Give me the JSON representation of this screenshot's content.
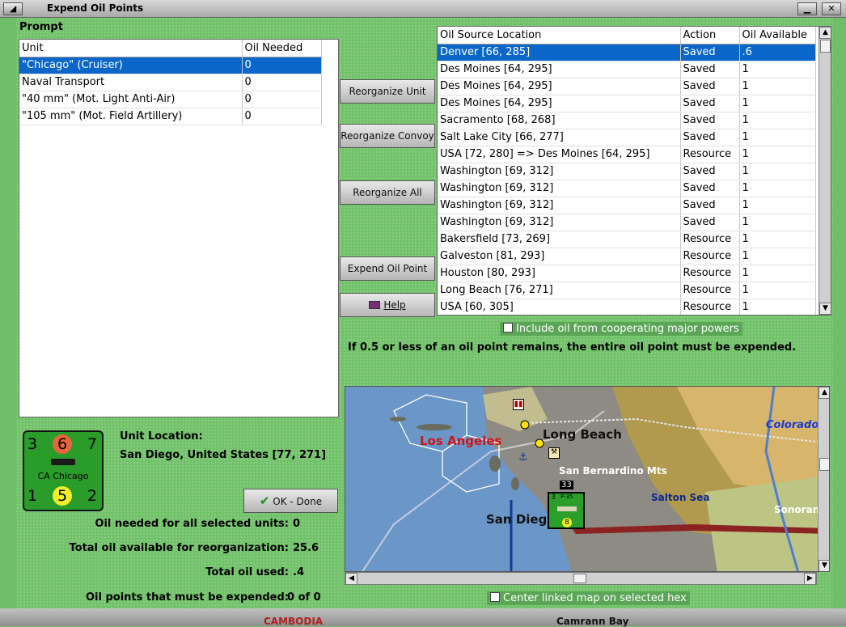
{
  "window": {
    "title": "Expend Oil Points"
  },
  "prompt_label": "Prompt",
  "units_table": {
    "headers": [
      "Unit",
      "Oil Needed"
    ],
    "rows": [
      {
        "unit": "\"Chicago\" (Cruiser)",
        "oil": "0",
        "selected": true
      },
      {
        "unit": "Naval Transport",
        "oil": "0"
      },
      {
        "unit": "\"40 mm\" (Mot. Light Anti-Air)",
        "oil": "0"
      },
      {
        "unit": "\"105 mm\" (Mot. Field Artillery)",
        "oil": "0"
      }
    ]
  },
  "buttons": {
    "reorganize_unit": "Reorganize Unit",
    "reorganize_convoy": "Reorganize Convoy",
    "reorganize_all": "Reorganize All",
    "expend_oil_point": "Expend Oil Point",
    "help": "Help",
    "ok_done": "OK - Done"
  },
  "oil_table": {
    "headers": [
      "Oil Source Location",
      "Action",
      "Oil Available"
    ],
    "rows": [
      {
        "loc": "Denver [66, 285]",
        "action": "Saved",
        "avail": ".6",
        "selected": true
      },
      {
        "loc": "Des Moines [64, 295]",
        "action": "Saved",
        "avail": "1"
      },
      {
        "loc": "Des Moines [64, 295]",
        "action": "Saved",
        "avail": "1"
      },
      {
        "loc": "Des Moines [64, 295]",
        "action": "Saved",
        "avail": "1"
      },
      {
        "loc": "Sacramento [68, 268]",
        "action": "Saved",
        "avail": "1"
      },
      {
        "loc": "Salt Lake City [66, 277]",
        "action": "Saved",
        "avail": "1"
      },
      {
        "loc": "USA [72, 280] => Des Moines [64, 295]",
        "action": "Resource",
        "avail": "1"
      },
      {
        "loc": "Washington [69, 312]",
        "action": "Saved",
        "avail": "1"
      },
      {
        "loc": "Washington [69, 312]",
        "action": "Saved",
        "avail": "1"
      },
      {
        "loc": "Washington [69, 312]",
        "action": "Saved",
        "avail": "1"
      },
      {
        "loc": "Washington [69, 312]",
        "action": "Saved",
        "avail": "1"
      },
      {
        "loc": "Bakersfield [73, 269]",
        "action": "Resource",
        "avail": "1"
      },
      {
        "loc": "Galveston [81, 293]",
        "action": "Resource",
        "avail": "1"
      },
      {
        "loc": "Houston [80, 293]",
        "action": "Resource",
        "avail": "1"
      },
      {
        "loc": "Long Beach [76, 271]",
        "action": "Resource",
        "avail": "1"
      },
      {
        "loc": "USA [60, 305]",
        "action": "Resource",
        "avail": "1"
      }
    ]
  },
  "include_cooperating": "Include oil from cooperating major powers",
  "notice": "If 0.5 or less of an oil point remains, the entire oil point must be expended.",
  "counter": {
    "tl": "3",
    "tm": "6",
    "tr": "7",
    "name": "CA Chicago",
    "bl": "1",
    "bm": "5",
    "br": "2"
  },
  "unit_location": {
    "label": "Unit Location:",
    "value": "San Diego, United States [77, 271]"
  },
  "stats": [
    {
      "label": "Oil needed for all selected units:",
      "value": "0"
    },
    {
      "label": "Total oil available for reorganization:",
      "value": "25.6"
    },
    {
      "label": "Total oil used:",
      "value": ".4"
    },
    {
      "label": "Oil points that must be expended:",
      "value": "0 of 0"
    }
  ],
  "map_labels": {
    "los_angeles": "Los Angeles",
    "long_beach": "Long Beach",
    "san_bernardino": "San Bernardino Mts",
    "salton_sea": "Salton Sea",
    "san_diego": "San Diego",
    "colorado": "Colorado",
    "sonoran": "Sonoran",
    "hex_number": "33",
    "unit_top_left": "3",
    "unit_top_mid": "P-35",
    "unit_bottom": "8"
  },
  "center_linked": "Center linked map on selected hex",
  "bottom_fragment_left": "CAMBODIA",
  "bottom_fragment_right": "Camrann Bay",
  "colors": {
    "selection": "#0a67c9",
    "background": "#72c26b",
    "red_label": "#d11414"
  }
}
